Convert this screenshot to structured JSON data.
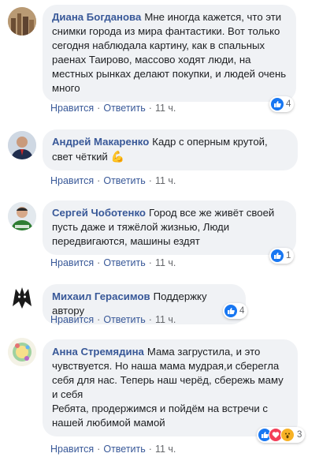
{
  "actions": {
    "like": "Нравится",
    "reply": "Ответить",
    "sep": "·"
  },
  "colors": {
    "link": "#385898",
    "bubble": "#f0f2f5",
    "like": "#1877f2",
    "love": "#f33e58",
    "wow": "#f7b125"
  },
  "comments": [
    {
      "author": "Диана Богданова",
      "text": "Мне иногда кажется, что эти снимки города из мира фантастики. Вот только сегодня наблюдала картину, как в спальных раенах Таирово, массово ходят люди, на местных рынках делают покупки, и людей очень много",
      "time": "11 ч.",
      "reactions": {
        "icons": [
          "like-icon"
        ],
        "count": "4"
      }
    },
    {
      "author": "Андрей Макаренко",
      "text": "Кадр с оперным крутой, свет чёткий",
      "emoji": "💪",
      "time": "11 ч."
    },
    {
      "author": "Сергей Чоботенко",
      "text": "Город все же живёт своей пусть даже и тяжёлой жизнью, Люди передвигаются, машины ездят",
      "time": "11 ч.",
      "reactions": {
        "icons": [
          "like-icon"
        ],
        "count": "1"
      }
    },
    {
      "author": "Михаил Герасимов",
      "text": "Поддержку автору",
      "time": "11 ч.",
      "reactions": {
        "icons": [
          "like-icon"
        ],
        "count": "4"
      }
    },
    {
      "author": "Анна Стремядина",
      "text": "Мама загрустила, и это чувствуется. Но наша мама мудрая,и сберегла себя для нас. Теперь наш черёд, сбережь маму и себя",
      "text2": "Ребята, продержимся и пойдём на встречи с нашей любимой мамой",
      "time": "11 ч.",
      "reactions": {
        "icons": [
          "like-icon",
          "love-icon",
          "wow-icon"
        ],
        "count": "3"
      }
    }
  ]
}
